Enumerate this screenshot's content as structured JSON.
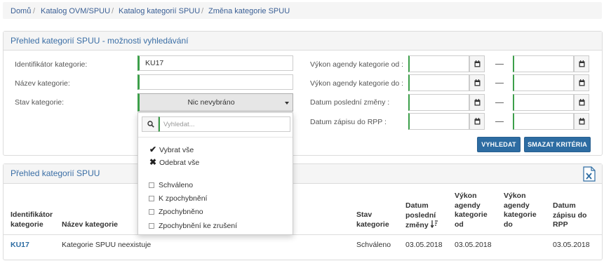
{
  "breadcrumb": {
    "items": [
      "Domů",
      "Katalog OVM/SPUU",
      "Katalog kategorií SPUU",
      "Změna kategorie SPUU"
    ],
    "separator": "/"
  },
  "search_panel": {
    "title": "Přehled kategorií SPUU - možnosti vyhledávání",
    "fields": {
      "identifier_label": "Identifikátor kategorie:",
      "identifier_value": "KU17",
      "name_label": "Název kategorie:",
      "name_value": "",
      "state_label": "Stav kategorie:",
      "state_value": "Nic nevybráno"
    },
    "date_fields": [
      {
        "label": "Výkon agendy kategorie od :"
      },
      {
        "label": "Výkon agendy kategorie do :"
      },
      {
        "label": "Datum poslední změny :"
      },
      {
        "label": "Datum zápisu do RPP :"
      }
    ],
    "date_separator": "—",
    "search_button": "VYHLEDAT",
    "clear_button": "SMAZAT KRITÉRIA"
  },
  "dropdown": {
    "search_placeholder": "Vyhledat...",
    "select_all": "Vybrat vše",
    "deselect_all": "Odebrat vše",
    "options": [
      "Schváleno",
      "K zpochybnění",
      "Zpochybněno",
      "Zpochybnění ke zrušení"
    ]
  },
  "results_panel": {
    "title": "Přehled kategorií SPUU",
    "columns": [
      "Identifikátor kategorie",
      "Název kategorie",
      "Stav kategorie",
      "Datum poslední změny",
      "Výkon agendy kategorie od",
      "Výkon agendy kategorie do",
      "Datum zápisu do RPP"
    ],
    "rows": [
      {
        "id": "KU17",
        "name": "Kategorie SPUU neexistuje",
        "state": "Schváleno",
        "last_change": "03.05.2018",
        "from": "03.05.2018",
        "to": "",
        "registered": "03.05.2018"
      }
    ]
  },
  "colors": {
    "accent": "#2d6ca2",
    "required_border": "#3c9f4a",
    "panel_title": "#3a6ea5"
  },
  "icons": {
    "calendar": "calendar-icon",
    "search": "search-icon",
    "caret": "caret-down-icon",
    "sort": "sort-icon",
    "excel": "excel-export-icon"
  }
}
